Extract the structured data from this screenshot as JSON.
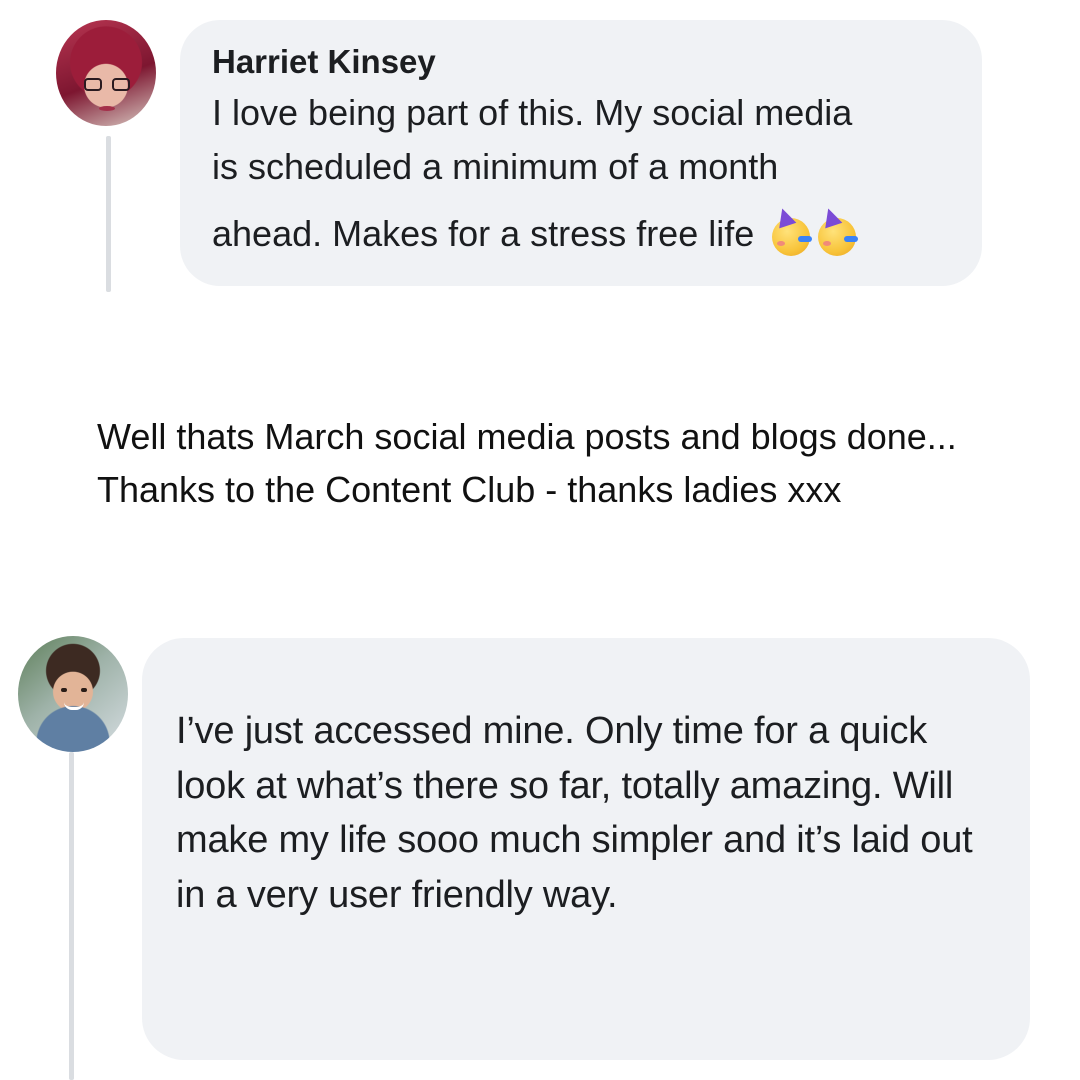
{
  "comment_1": {
    "author": "Harriet Kinsey",
    "text_lines": [
      "I love being part of this. My social media",
      "is scheduled a minimum of a month"
    ],
    "text_last_line": "ahead. Makes for a stress free life",
    "emojis": [
      "partying-face-icon",
      "partying-face-icon"
    ]
  },
  "caption": {
    "text": "Well thats March social media posts and blogs done... Thanks to the Content Club - thanks ladies xxx"
  },
  "comment_2": {
    "text": "I’ve just accessed mine. Only time for a quick look at what’s there so far, totally amazing. Will make my life sooo much simpler and it’s laid out in a very user friendly way."
  },
  "colors": {
    "bubble_bg": "#f0f2f5",
    "thread_line": "#dadde1",
    "text": "#1c1e21"
  }
}
